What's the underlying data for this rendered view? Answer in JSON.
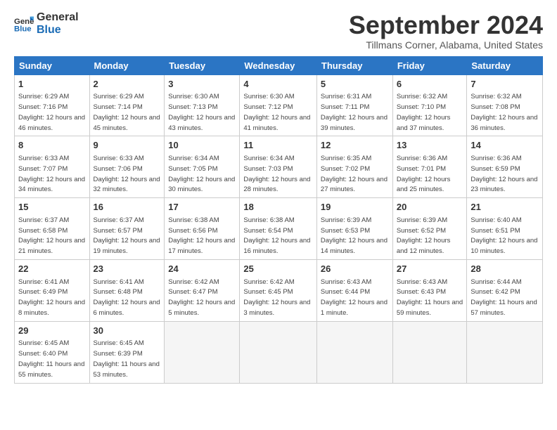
{
  "header": {
    "logo_line1": "General",
    "logo_line2": "Blue",
    "month_title": "September 2024",
    "location": "Tillmans Corner, Alabama, United States"
  },
  "days_of_week": [
    "Sunday",
    "Monday",
    "Tuesday",
    "Wednesday",
    "Thursday",
    "Friday",
    "Saturday"
  ],
  "weeks": [
    [
      {
        "day": "1",
        "sunrise": "6:29 AM",
        "sunset": "7:16 PM",
        "daylight": "12 hours and 46 minutes."
      },
      {
        "day": "2",
        "sunrise": "6:29 AM",
        "sunset": "7:14 PM",
        "daylight": "12 hours and 45 minutes."
      },
      {
        "day": "3",
        "sunrise": "6:30 AM",
        "sunset": "7:13 PM",
        "daylight": "12 hours and 43 minutes."
      },
      {
        "day": "4",
        "sunrise": "6:30 AM",
        "sunset": "7:12 PM",
        "daylight": "12 hours and 41 minutes."
      },
      {
        "day": "5",
        "sunrise": "6:31 AM",
        "sunset": "7:11 PM",
        "daylight": "12 hours and 39 minutes."
      },
      {
        "day": "6",
        "sunrise": "6:32 AM",
        "sunset": "7:10 PM",
        "daylight": "12 hours and 37 minutes."
      },
      {
        "day": "7",
        "sunrise": "6:32 AM",
        "sunset": "7:08 PM",
        "daylight": "12 hours and 36 minutes."
      }
    ],
    [
      {
        "day": "8",
        "sunrise": "6:33 AM",
        "sunset": "7:07 PM",
        "daylight": "12 hours and 34 minutes."
      },
      {
        "day": "9",
        "sunrise": "6:33 AM",
        "sunset": "7:06 PM",
        "daylight": "12 hours and 32 minutes."
      },
      {
        "day": "10",
        "sunrise": "6:34 AM",
        "sunset": "7:05 PM",
        "daylight": "12 hours and 30 minutes."
      },
      {
        "day": "11",
        "sunrise": "6:34 AM",
        "sunset": "7:03 PM",
        "daylight": "12 hours and 28 minutes."
      },
      {
        "day": "12",
        "sunrise": "6:35 AM",
        "sunset": "7:02 PM",
        "daylight": "12 hours and 27 minutes."
      },
      {
        "day": "13",
        "sunrise": "6:36 AM",
        "sunset": "7:01 PM",
        "daylight": "12 hours and 25 minutes."
      },
      {
        "day": "14",
        "sunrise": "6:36 AM",
        "sunset": "6:59 PM",
        "daylight": "12 hours and 23 minutes."
      }
    ],
    [
      {
        "day": "15",
        "sunrise": "6:37 AM",
        "sunset": "6:58 PM",
        "daylight": "12 hours and 21 minutes."
      },
      {
        "day": "16",
        "sunrise": "6:37 AM",
        "sunset": "6:57 PM",
        "daylight": "12 hours and 19 minutes."
      },
      {
        "day": "17",
        "sunrise": "6:38 AM",
        "sunset": "6:56 PM",
        "daylight": "12 hours and 17 minutes."
      },
      {
        "day": "18",
        "sunrise": "6:38 AM",
        "sunset": "6:54 PM",
        "daylight": "12 hours and 16 minutes."
      },
      {
        "day": "19",
        "sunrise": "6:39 AM",
        "sunset": "6:53 PM",
        "daylight": "12 hours and 14 minutes."
      },
      {
        "day": "20",
        "sunrise": "6:39 AM",
        "sunset": "6:52 PM",
        "daylight": "12 hours and 12 minutes."
      },
      {
        "day": "21",
        "sunrise": "6:40 AM",
        "sunset": "6:51 PM",
        "daylight": "12 hours and 10 minutes."
      }
    ],
    [
      {
        "day": "22",
        "sunrise": "6:41 AM",
        "sunset": "6:49 PM",
        "daylight": "12 hours and 8 minutes."
      },
      {
        "day": "23",
        "sunrise": "6:41 AM",
        "sunset": "6:48 PM",
        "daylight": "12 hours and 6 minutes."
      },
      {
        "day": "24",
        "sunrise": "6:42 AM",
        "sunset": "6:47 PM",
        "daylight": "12 hours and 5 minutes."
      },
      {
        "day": "25",
        "sunrise": "6:42 AM",
        "sunset": "6:45 PM",
        "daylight": "12 hours and 3 minutes."
      },
      {
        "day": "26",
        "sunrise": "6:43 AM",
        "sunset": "6:44 PM",
        "daylight": "12 hours and 1 minute."
      },
      {
        "day": "27",
        "sunrise": "6:43 AM",
        "sunset": "6:43 PM",
        "daylight": "11 hours and 59 minutes."
      },
      {
        "day": "28",
        "sunrise": "6:44 AM",
        "sunset": "6:42 PM",
        "daylight": "11 hours and 57 minutes."
      }
    ],
    [
      {
        "day": "29",
        "sunrise": "6:45 AM",
        "sunset": "6:40 PM",
        "daylight": "11 hours and 55 minutes."
      },
      {
        "day": "30",
        "sunrise": "6:45 AM",
        "sunset": "6:39 PM",
        "daylight": "11 hours and 53 minutes."
      },
      null,
      null,
      null,
      null,
      null
    ]
  ]
}
